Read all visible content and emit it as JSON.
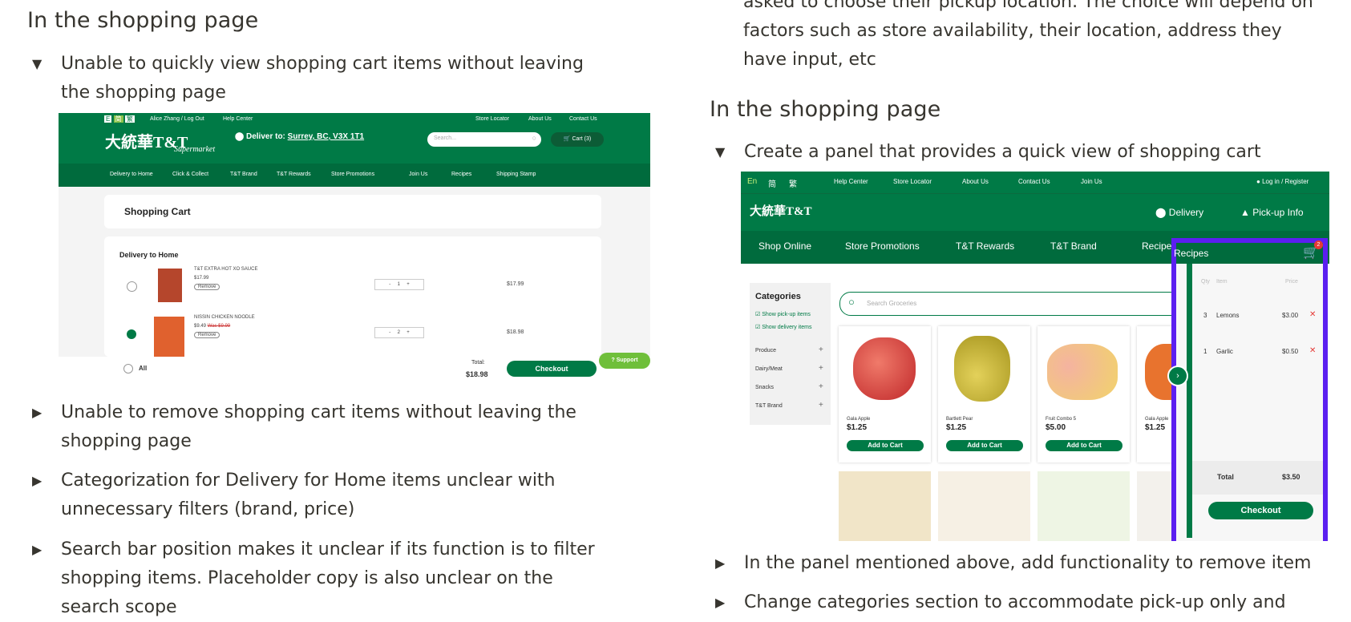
{
  "left": {
    "heading": "In the shopping page",
    "item1": "Unable to quickly view shopping cart items without leaving the shopping page",
    "item2": "Unable to remove shopping cart items without leaving the shopping page",
    "item3": "Categorization for Delivery for Home items unclear with unnecessary filters (brand, price)",
    "item4": "Search bar position makes it unclear if its function is to filter shopping items. Placeholder copy is also unclear on the search scope",
    "shot": {
      "user": "Alice Zhang / Log Out",
      "help": "Help Center",
      "top_links": [
        "Store Locator",
        "About Us",
        "Contact Us"
      ],
      "logo": "大統華T&T",
      "logo_sub": "Supermarket",
      "deliver_label": "Deliver to:",
      "deliver_addr": "Surrey, BC, V3X 1T1",
      "search_ph": "Search...",
      "cart_btn": "Cart (3)",
      "nav": [
        "Delivery to Home",
        "Click & Collect",
        "T&T Brand",
        "T&T Rewards",
        "Store Promotions",
        "Join Us",
        "Recipes",
        "Shipping Stamp"
      ],
      "cart_title": "Shopping Cart",
      "section": "Delivery to Home",
      "items": [
        {
          "name": "T&T EXTRA HOT XO SAUCE",
          "price": "$17.99",
          "old": "",
          "remove": "Remove",
          "qty": "1",
          "total": "$17.99"
        },
        {
          "name": "NISSIN CHICKEN NOODLE",
          "price": "$9.49",
          "old": "Was $9.99",
          "remove": "Remove",
          "qty": "2",
          "total": "$18.98"
        }
      ],
      "all": "All",
      "total_label": "Total:",
      "total": "$18.98",
      "checkout": "Checkout",
      "support": "Support"
    }
  },
  "right": {
    "top_text": "asked to choose their pickup location. The choice will depend on factors such as store availability, their location, address they have input, etc",
    "heading": "In the shopping page",
    "item1": "Create a panel that provides a quick view of shopping cart",
    "item2": "In the panel mentioned above, add functionality to remove item",
    "item3": "Change categories section to accommodate pick-up only and",
    "shot": {
      "langs": [
        "En",
        "简",
        "繁"
      ],
      "links": [
        "Help Center",
        "Store Locator",
        "About Us",
        "Contact Us",
        "Join Us"
      ],
      "login": "Log in / Register",
      "logo": "大統華T&T",
      "delivery": "Delivery",
      "pickup": "Pick-up Info",
      "nav": [
        "Shop Online",
        "Store Promotions",
        "T&T Rewards",
        "T&T Brand",
        "Recipes"
      ],
      "cart_badge": "2",
      "categories_title": "Categories",
      "show_pickup": "Show pick-up items",
      "show_delivery": "Show delivery items",
      "categories": [
        "Produce",
        "Dairy/Meat",
        "Snacks",
        "T&T Brand"
      ],
      "search_ph": "Search Groceries",
      "products": [
        {
          "name": "Gala Apple",
          "price": "$1.25"
        },
        {
          "name": "Bartlett Pear",
          "price": "$1.25"
        },
        {
          "name": "Fruit Combo 5",
          "price": "$5.00"
        },
        {
          "name": "Gala Apple",
          "price": "$1.25"
        }
      ],
      "add_to_cart": "Add to Cart",
      "cart_cols": [
        "Qty",
        "Item",
        "Price"
      ],
      "cart_items": [
        {
          "qty": "3",
          "item": "Lemons",
          "price": "$3.00"
        },
        {
          "qty": "1",
          "item": "Garlic",
          "price": "$0.50"
        }
      ],
      "total_label": "Total",
      "total": "$3.50",
      "checkout": "Checkout"
    }
  }
}
